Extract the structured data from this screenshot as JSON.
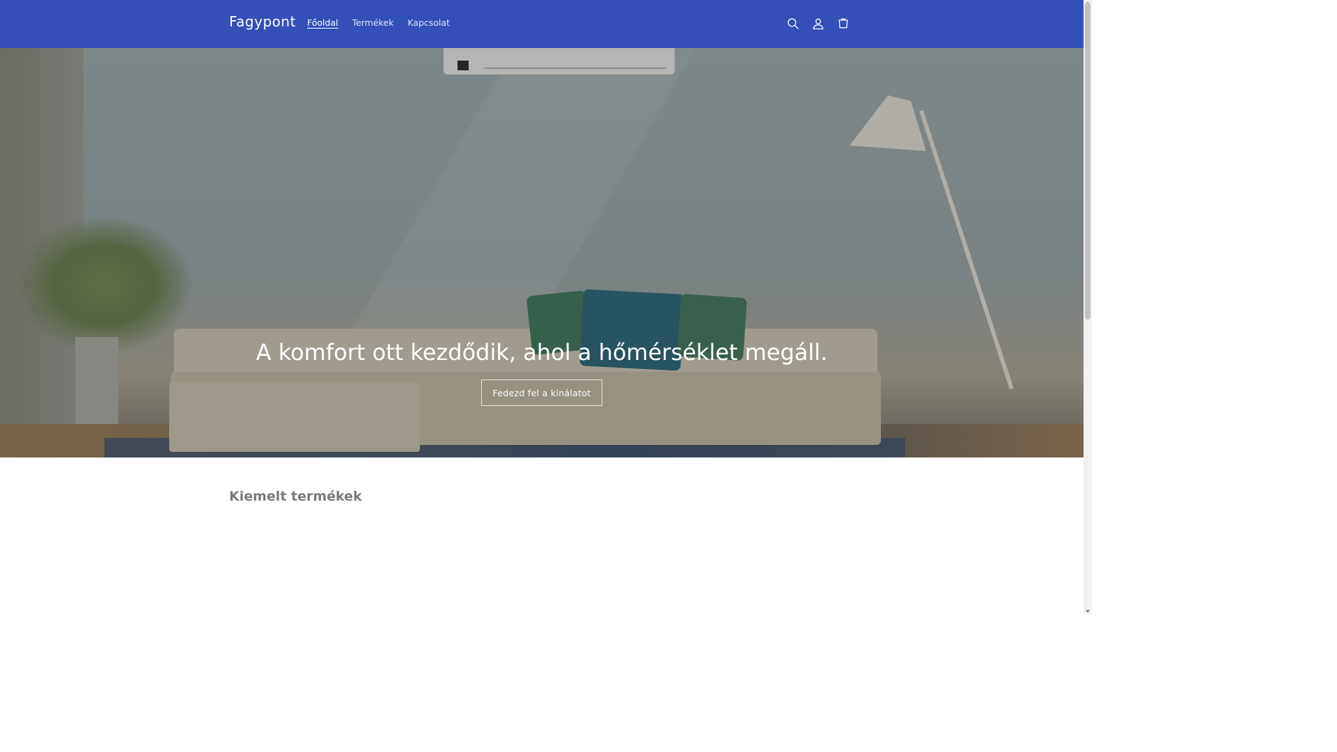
{
  "header": {
    "brand": "Fagypont",
    "nav": [
      {
        "label": "Főoldal",
        "active": true
      },
      {
        "label": "Termékek",
        "active": false
      },
      {
        "label": "Kapcsolat",
        "active": false
      }
    ],
    "icons": [
      "search-icon",
      "account-icon",
      "cart-icon"
    ],
    "background_color": "#344fb8"
  },
  "hero": {
    "title": "A komfort ott kezdődik, ahol a hőmérséklet megáll.",
    "button_label": "Fedezd fel a kínálatot"
  },
  "featured": {
    "title": "Kiemelt termékek"
  }
}
